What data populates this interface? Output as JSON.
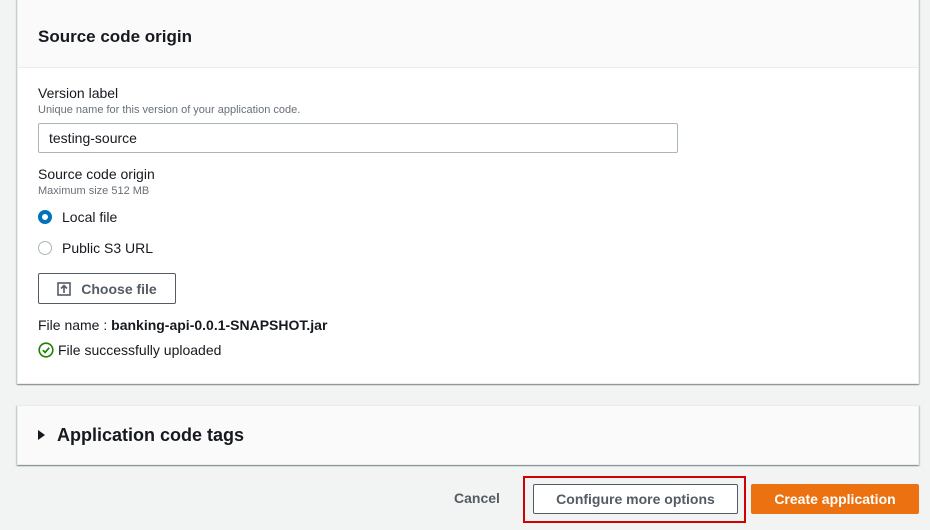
{
  "source_panel": {
    "title": "Source code origin",
    "version_label": {
      "label": "Version label",
      "description": "Unique name for this version of your application code.",
      "value": "testing-source"
    },
    "origin": {
      "label": "Source code origin",
      "description": "Maximum size 512 MB",
      "options": [
        {
          "label": "Local file",
          "selected": true
        },
        {
          "label": "Public S3 URL",
          "selected": false
        }
      ]
    },
    "choose_file": {
      "label": "Choose file",
      "icon": "upload-icon"
    },
    "file_name": {
      "prefix": "File name :",
      "value": "banking-api-0.0.1-SNAPSHOT.jar"
    },
    "upload_status": {
      "text": "File successfully uploaded",
      "icon": "check-circle-icon",
      "color": "#1d8102"
    }
  },
  "tags_panel": {
    "title": "Application code tags",
    "icon": "caret-right-icon"
  },
  "footer": {
    "cancel_label": "Cancel",
    "configure_label": "Configure more options",
    "create_label": "Create application"
  },
  "colors": {
    "primary": "#ec7211",
    "selected_radio": "#0073bb",
    "highlight_box": "#d20000"
  }
}
